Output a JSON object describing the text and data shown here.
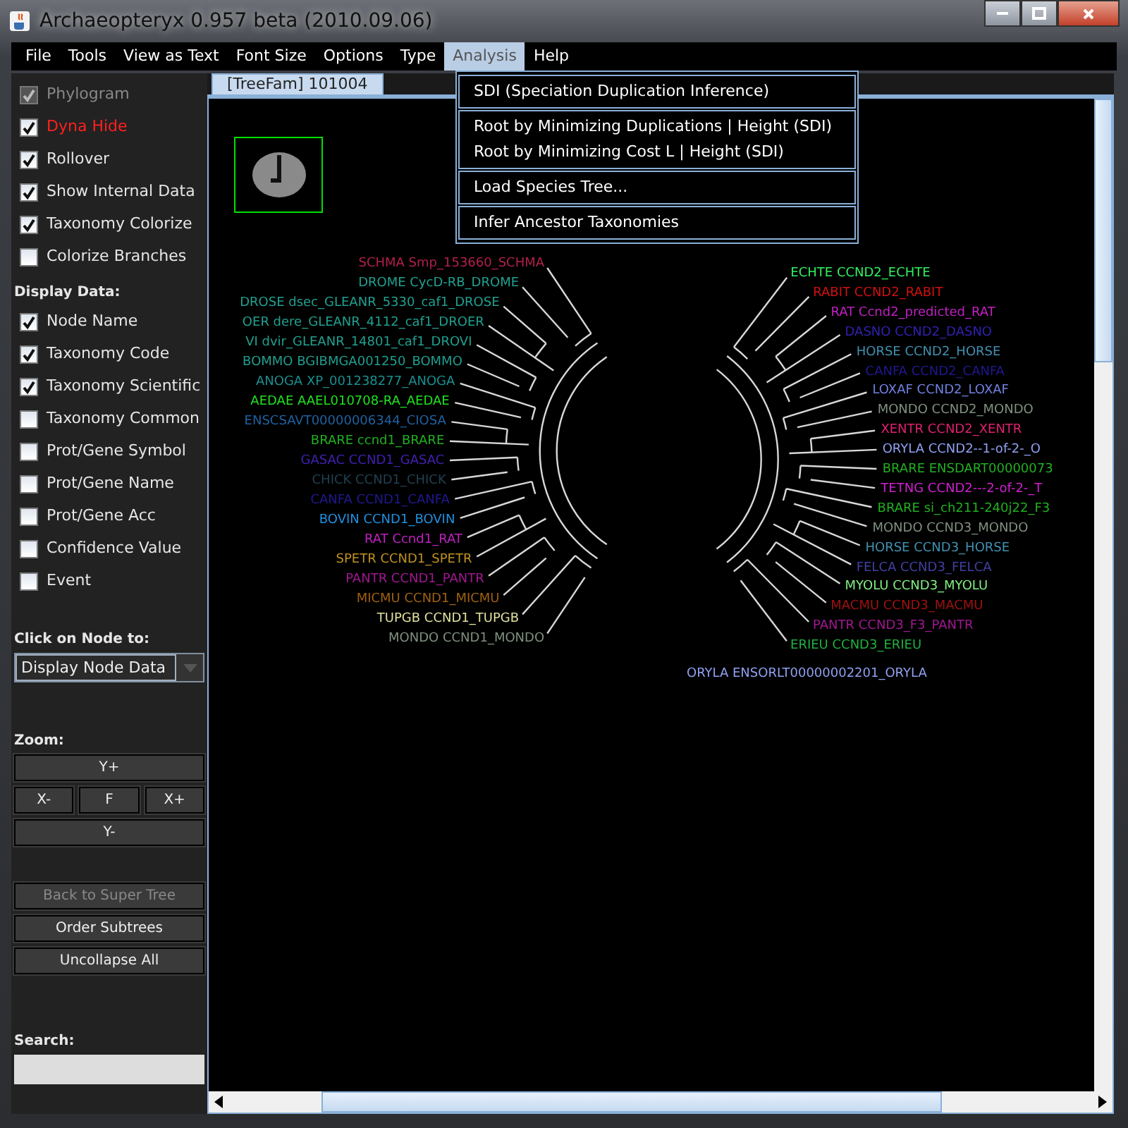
{
  "window": {
    "title": "Archaeopteryx 0.957 beta (2010.09.06)"
  },
  "menu_bar": [
    {
      "label": "File",
      "selected": false
    },
    {
      "label": "Tools",
      "selected": false
    },
    {
      "label": "View as Text",
      "selected": false
    },
    {
      "label": "Font Size",
      "selected": false
    },
    {
      "label": "Options",
      "selected": false
    },
    {
      "label": "Type",
      "selected": false
    },
    {
      "label": "Analysis",
      "selected": true
    },
    {
      "label": "Help",
      "selected": false
    }
  ],
  "open_menu": {
    "groups": [
      [
        "SDI (Speciation Duplication Inference)"
      ],
      [
        "Root by Minimizing Duplications | Height (SDI)",
        "Root by Minimizing Cost L | Height (SDI)"
      ],
      [
        "Load Species Tree..."
      ],
      [
        "Infer Ancestor Taxonomies"
      ]
    ]
  },
  "sidebar": {
    "options": [
      {
        "label": "Phylogram",
        "checked": true,
        "disabled": true,
        "highlighted": false
      },
      {
        "label": "Dyna Hide",
        "checked": true,
        "disabled": false,
        "highlighted": true
      },
      {
        "label": "Rollover",
        "checked": true,
        "disabled": false,
        "highlighted": false
      },
      {
        "label": "Show Internal Data",
        "checked": true,
        "disabled": false,
        "highlighted": false
      },
      {
        "label": "Taxonomy Colorize",
        "checked": true,
        "disabled": false,
        "highlighted": false
      },
      {
        "label": "Colorize Branches",
        "checked": false,
        "disabled": false,
        "highlighted": false
      }
    ],
    "display_heading": "Display Data:",
    "display_options": [
      {
        "label": "Node Name",
        "checked": true
      },
      {
        "label": "Taxonomy Code",
        "checked": true
      },
      {
        "label": "Taxonomy Scientific",
        "checked": true
      },
      {
        "label": "Taxonomy Common",
        "checked": false
      },
      {
        "label": "Prot/Gene Symbol",
        "checked": false
      },
      {
        "label": "Prot/Gene Name",
        "checked": false
      },
      {
        "label": "Prot/Gene Acc",
        "checked": false
      },
      {
        "label": "Confidence Value",
        "checked": false
      },
      {
        "label": "Event",
        "checked": false
      }
    ],
    "click_heading": "Click on Node to:",
    "click_action": {
      "value": "Display Node Data"
    },
    "zoom_heading": "Zoom:",
    "zoom_buttons": [
      [
        "Y+"
      ],
      [
        "X-",
        "F",
        "X+"
      ],
      [
        "Y-"
      ]
    ],
    "actions": [
      {
        "label": "Back to Super Tree",
        "disabled": true
      },
      {
        "label": "Order Subtrees",
        "disabled": false
      },
      {
        "label": "Uncollapse All",
        "disabled": false
      }
    ],
    "search_heading": "Search:"
  },
  "tab": {
    "label": "[TreeFam] 101004",
    "selected": true
  },
  "tree": {
    "left_labels": [
      {
        "text": "SCHMA  Smp_153660_SCHMA",
        "color": "#b0204a"
      },
      {
        "text": "DROME  CycD-RB_DROME",
        "color": "#20a090"
      },
      {
        "text": "DROSE  dsec_GLEANR_5330_caf1_DROSE",
        "color": "#20a090"
      },
      {
        "text": "OER  dere_GLEANR_4112_caf1_DROER",
        "color": "#20a090"
      },
      {
        "text": "VI  dvir_GLEANR_14801_caf1_DROVI",
        "color": "#20a090"
      },
      {
        "text": "BOMMO  BGIBMGA001250_BOMMO",
        "color": "#1f9f8f"
      },
      {
        "text": "ANOGA  XP_001238277_ANOGA",
        "color": "#1a8f8f"
      },
      {
        "text": "AEDAE  AAEL010708-RA_AEDAE",
        "color": "#20e020"
      },
      {
        "text": "ENSCSAVT00000006344_CIOSA",
        "color": "#2060a0"
      },
      {
        "text": "BRARE  ccnd1_BRARE",
        "color": "#20b020"
      },
      {
        "text": "GASAC  CCND1_GASAC",
        "color": "#4020b0"
      },
      {
        "text": "CHICK  CCND1_CHICK",
        "color": "#204050"
      },
      {
        "text": "CANFA  CCND1_CANFA",
        "color": "#201890"
      },
      {
        "text": "BOVIN  CCND1_BOVIN",
        "color": "#2090e0"
      },
      {
        "text": "RAT  Ccnd1_RAT",
        "color": "#c020c0"
      },
      {
        "text": "SPETR  CCND1_SPETR",
        "color": "#c09020"
      },
      {
        "text": "PANTR  CCND1_PANTR",
        "color": "#a01890"
      },
      {
        "text": "MICMU  CCND1_MICMU",
        "color": "#a06010"
      },
      {
        "text": "TUPGB  CCND1_TUPGB",
        "color": "#e0e0a0"
      },
      {
        "text": "MONDO  CCND1_MONDO",
        "color": "#809080"
      }
    ],
    "right_labels": [
      {
        "text": "ECHTE  CCND2_ECHTE",
        "color": "#30f060"
      },
      {
        "text": "RABIT  CCND2_RABIT",
        "color": "#d01010"
      },
      {
        "text": "RAT  Ccnd2_predicted_RAT",
        "color": "#c020c0"
      },
      {
        "text": "DASNO  CCND2_DASNO",
        "color": "#3020b0"
      },
      {
        "text": "HORSE  CCND2_HORSE",
        "color": "#4090b0"
      },
      {
        "text": "CANFA  CCND2_CANFA",
        "color": "#201890"
      },
      {
        "text": "LOXAF  CCND2_LOXAF",
        "color": "#7080e0"
      },
      {
        "text": "MONDO  CCND2_MONDO",
        "color": "#809080"
      },
      {
        "text": "XENTR  CCND2_XENTR",
        "color": "#e02070"
      },
      {
        "text": "ORYLA  CCND2--1-of-2-_O",
        "color": "#90a0f0"
      },
      {
        "text": "BRARE  ENSDART00000073",
        "color": "#20b020"
      },
      {
        "text": "TETNG  CCND2---2-of-2-_T",
        "color": "#d020d0"
      },
      {
        "text": "BRARE  si_ch211-240j22_F3",
        "color": "#20b020"
      },
      {
        "text": "MONDO  CCND3_MONDO",
        "color": "#809080"
      },
      {
        "text": "HORSE  CCND3_HORSE",
        "color": "#4090b0"
      },
      {
        "text": "FELCA  CCND3_FELCA",
        "color": "#4040a0"
      },
      {
        "text": "MYOLU  CCND3_MYOLU",
        "color": "#80f080"
      },
      {
        "text": "MACMU  CCND3_MACMU",
        "color": "#a01010"
      },
      {
        "text": "PANTR  CCND3_F3_PANTR",
        "color": "#a01890"
      },
      {
        "text": "ERIEU  CCND3_ERIEU",
        "color": "#20b040"
      }
    ],
    "bottom_labels": [
      {
        "text": "ORYLA  ENSORLT00000002201_ORYLA",
        "color": "#90a0f0"
      }
    ]
  }
}
